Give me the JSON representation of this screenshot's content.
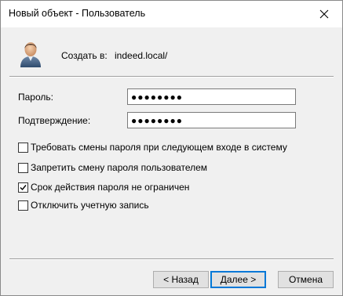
{
  "window": {
    "title": "Новый объект - Пользователь"
  },
  "header": {
    "create_in_label": "Создать в:",
    "create_in_path": "indeed.local/"
  },
  "fields": [
    {
      "label": "Пароль:",
      "value": "●●●●●●●●"
    },
    {
      "label": "Подтверждение:",
      "value": "●●●●●●●●"
    }
  ],
  "checkboxes": [
    {
      "label": "Требовать смены пароля при следующем входе в систему",
      "checked": false
    },
    {
      "label": "Запретить смену пароля пользователем",
      "checked": false
    },
    {
      "label": "Срок действия пароля не ограничен",
      "checked": true
    },
    {
      "label": "Отключить учетную запись",
      "checked": false
    }
  ],
  "buttons": {
    "back": "< Назад",
    "next": "Далее >",
    "cancel": "Отмена"
  },
  "icons": {
    "close": "close-icon",
    "user": "user-icon",
    "check": "checkmark-icon"
  }
}
